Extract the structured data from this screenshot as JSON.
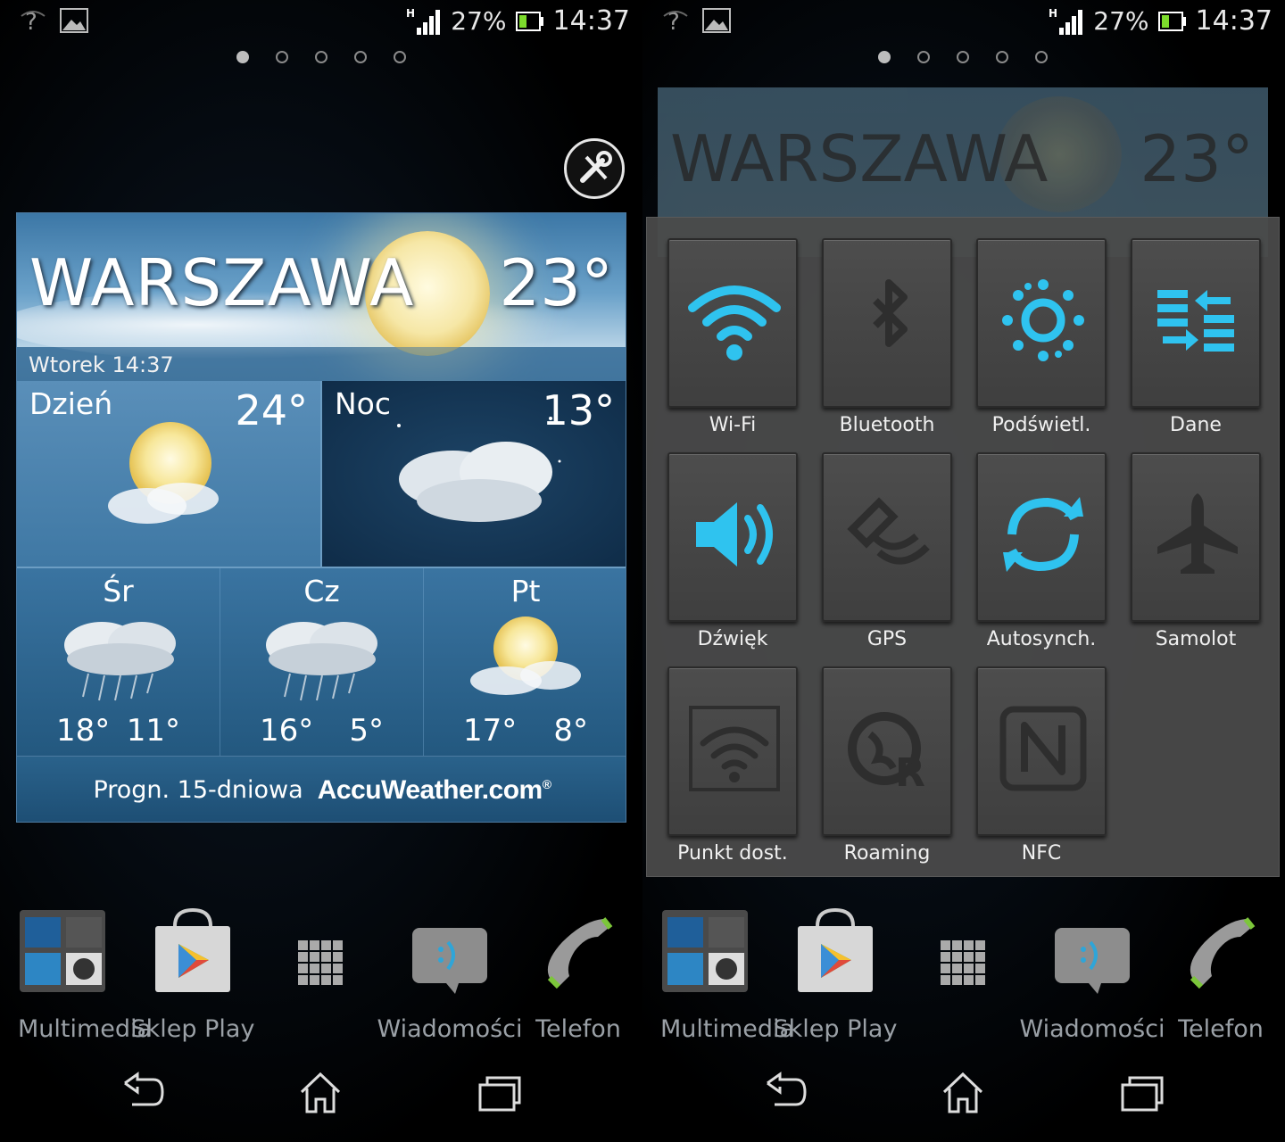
{
  "status": {
    "battery_pct": "27%",
    "time": "14:37",
    "network": "H"
  },
  "pager": {
    "pages": 5,
    "active": 0
  },
  "weather": {
    "city": "WARSZAWA",
    "temp": "23°",
    "date": "Wtorek 14:37",
    "day_label": "Dzień",
    "day_temp": "24°",
    "night_label": "Noc",
    "night_temp": "13°",
    "forecast": [
      {
        "day": "Śr",
        "hi": "18°",
        "lo": "11°",
        "icon": "rain-cloud-icon"
      },
      {
        "day": "Cz",
        "hi": "16°",
        "lo": "5°",
        "icon": "rain-cloud-icon"
      },
      {
        "day": "Pt",
        "hi": "17°",
        "lo": "8°",
        "icon": "sun-cloud-icon"
      }
    ],
    "footer": "Progn. 15-dniowa",
    "brand": "AccuWeather.com",
    "brand_mark": "®"
  },
  "dock": [
    {
      "label": "Multimedia",
      "icon": "multimedia-folder-icon"
    },
    {
      "label": "Sklep Play",
      "icon": "play-store-icon"
    },
    {
      "label": "",
      "icon": "app-drawer-icon"
    },
    {
      "label": "Wiadomości",
      "icon": "messages-icon"
    },
    {
      "label": "Telefon",
      "icon": "phone-icon"
    }
  ],
  "quick_settings": [
    {
      "label": "Wi-Fi",
      "active": true,
      "icon": "wifi-icon"
    },
    {
      "label": "Bluetooth",
      "active": false,
      "icon": "bluetooth-icon"
    },
    {
      "label": "Podświetl.",
      "active": true,
      "icon": "brightness-icon"
    },
    {
      "label": "Dane",
      "active": true,
      "icon": "data-icon"
    },
    {
      "label": "Dźwięk",
      "active": true,
      "icon": "sound-icon"
    },
    {
      "label": "GPS",
      "active": false,
      "icon": "gps-icon"
    },
    {
      "label": "Autosynch.",
      "active": true,
      "icon": "sync-icon"
    },
    {
      "label": "Samolot",
      "active": false,
      "icon": "airplane-icon"
    },
    {
      "label": "Punkt dost.",
      "active": false,
      "icon": "hotspot-icon"
    },
    {
      "label": "Roaming",
      "active": false,
      "icon": "roaming-icon"
    },
    {
      "label": "NFC",
      "active": false,
      "icon": "nfc-icon"
    }
  ],
  "colors": {
    "accent": "#2fc3ef",
    "inactive": "#2e2e2e"
  }
}
